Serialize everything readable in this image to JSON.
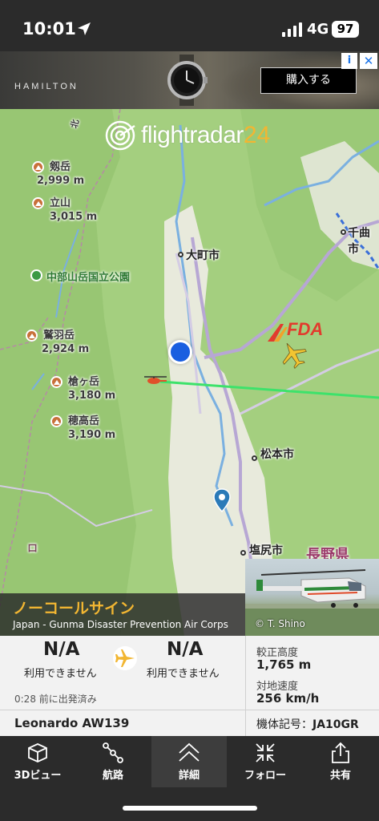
{
  "status_bar": {
    "time": "10:01",
    "network": "4G",
    "battery": "97"
  },
  "ad": {
    "brand": "HAMILTON",
    "cta": "購入する",
    "info": "i",
    "close": "✕"
  },
  "map": {
    "logo_part1": "flightradar",
    "logo_part2": "24",
    "peaks": [
      {
        "name": "剱岳",
        "elevation": "2,999 m"
      },
      {
        "name": "立山",
        "elevation": "3,015 m"
      },
      {
        "name": "鷲羽岳",
        "elevation": "2,924 m"
      },
      {
        "name": "槍ヶ岳",
        "elevation": "3,180 m"
      },
      {
        "name": "穂高岳",
        "elevation": "3,190 m"
      }
    ],
    "park": "中部山岳国立公園",
    "cities": [
      "大町市",
      "千曲市",
      "松本市",
      "塩尻市"
    ],
    "prefecture": "長野県",
    "airline_logo": "FDA",
    "route_marker": "北",
    "road_marker": "ロ"
  },
  "flight": {
    "callsign": "ノーコールサイン",
    "operator": "Japan - Gunma Disaster Prevention Air Corps",
    "photo_credit": "© T. Shino",
    "departure": {
      "code": "N/A",
      "status": "利用できません"
    },
    "arrival": {
      "code": "N/A",
      "status": "利用できません"
    },
    "elapsed": "0:28 前に出発済み",
    "calibrated_altitude_label": "較正高度",
    "calibrated_altitude": "1,765 m",
    "ground_speed_label": "対地速度",
    "ground_speed": "256 km/h",
    "aircraft_type": "Leonardo AW139",
    "registration_label": "機体記号：",
    "registration": "JA10GR"
  },
  "tabs": [
    {
      "label": "3Dビュー",
      "icon": "cube-icon"
    },
    {
      "label": "航路",
      "icon": "route-icon"
    },
    {
      "label": "詳細",
      "icon": "chevron-up-icon",
      "active": true
    },
    {
      "label": "フォロー",
      "icon": "follow-icon"
    },
    {
      "label": "共有",
      "icon": "share-icon"
    }
  ],
  "colors": {
    "accent": "#f2b632",
    "map_green": "#a4cf7f",
    "track": "#3de26b",
    "location": "#1a5fe0"
  }
}
